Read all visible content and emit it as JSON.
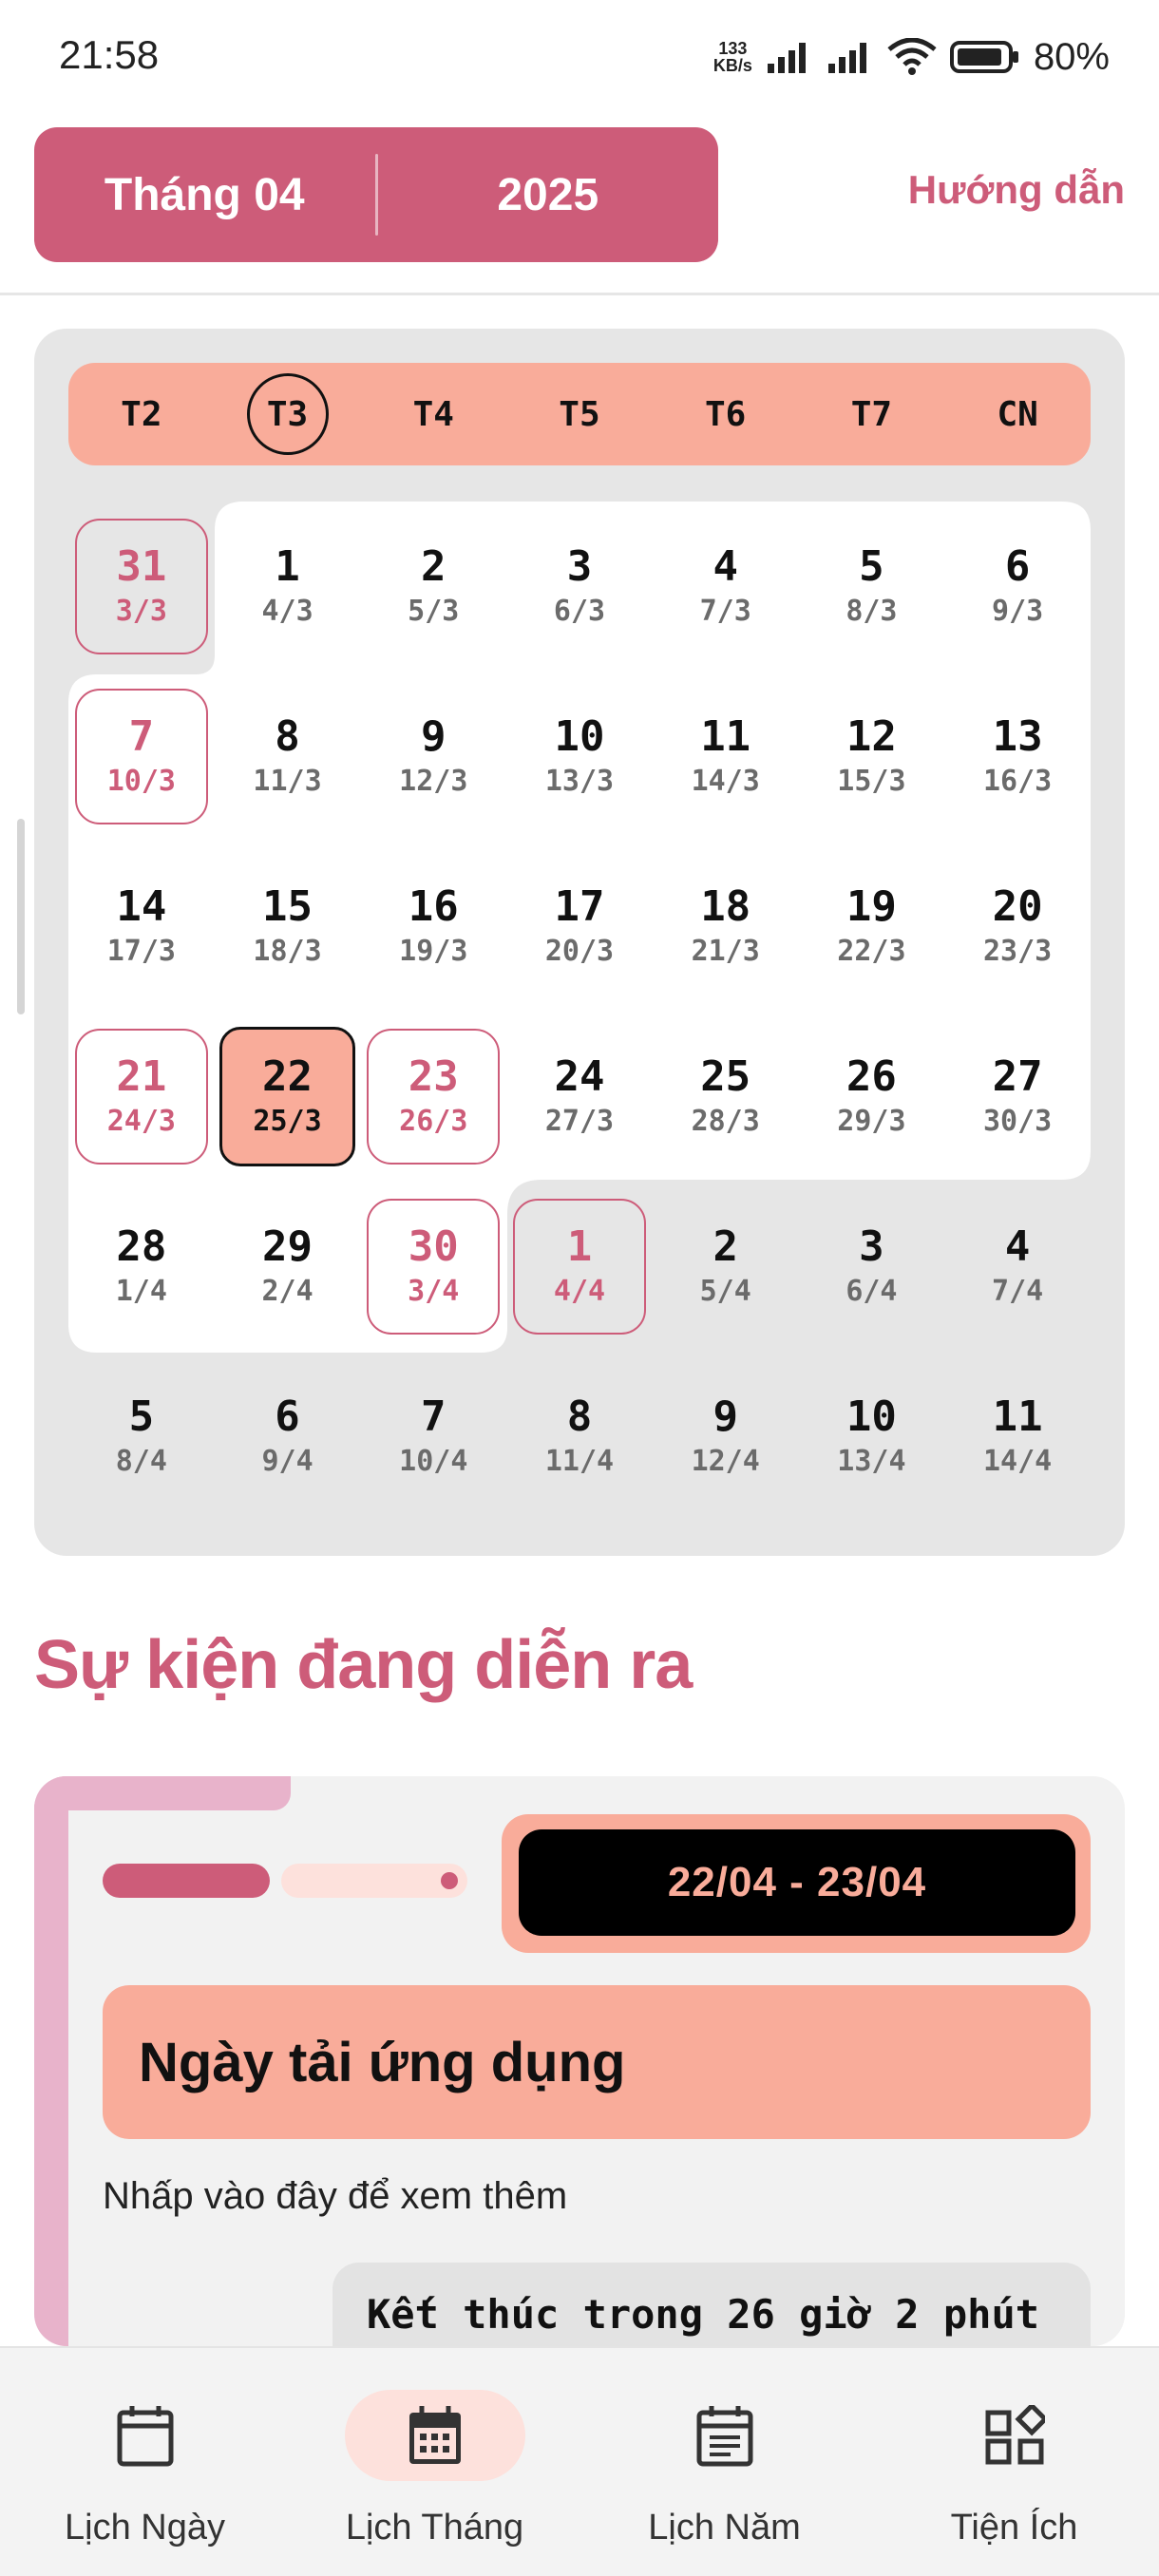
{
  "status_bar": {
    "time": "21:58",
    "net_speed_value": "133",
    "net_speed_unit": "KB/s",
    "battery": "80%",
    "icons": [
      "signal-icon",
      "signal-icon",
      "wifi-icon",
      "battery-icon"
    ]
  },
  "header": {
    "month_label": "Tháng 04",
    "year_label": "2025",
    "guide_link": "Hướng dẫn",
    "accent_color": "#cd5c79"
  },
  "calendar": {
    "weekdays": [
      "T2",
      "T3",
      "T4",
      "T5",
      "T6",
      "T7",
      "CN"
    ],
    "current_weekday": "T3",
    "weeks": [
      [
        {
          "solar": "31",
          "lunar": "3/3",
          "style": "outline"
        },
        {
          "solar": "1",
          "lunar": "4/3"
        },
        {
          "solar": "2",
          "lunar": "5/3"
        },
        {
          "solar": "3",
          "lunar": "6/3"
        },
        {
          "solar": "4",
          "lunar": "7/3"
        },
        {
          "solar": "5",
          "lunar": "8/3"
        },
        {
          "solar": "6",
          "lunar": "9/3"
        }
      ],
      [
        {
          "solar": "7",
          "lunar": "10/3",
          "style": "outline"
        },
        {
          "solar": "8",
          "lunar": "11/3"
        },
        {
          "solar": "9",
          "lunar": "12/3"
        },
        {
          "solar": "10",
          "lunar": "13/3"
        },
        {
          "solar": "11",
          "lunar": "14/3"
        },
        {
          "solar": "12",
          "lunar": "15/3"
        },
        {
          "solar": "13",
          "lunar": "16/3"
        }
      ],
      [
        {
          "solar": "14",
          "lunar": "17/3"
        },
        {
          "solar": "15",
          "lunar": "18/3"
        },
        {
          "solar": "16",
          "lunar": "19/3"
        },
        {
          "solar": "17",
          "lunar": "20/3"
        },
        {
          "solar": "18",
          "lunar": "21/3"
        },
        {
          "solar": "19",
          "lunar": "22/3"
        },
        {
          "solar": "20",
          "lunar": "23/3"
        }
      ],
      [
        {
          "solar": "21",
          "lunar": "24/3",
          "style": "outline"
        },
        {
          "solar": "22",
          "lunar": "25/3",
          "style": "selected"
        },
        {
          "solar": "23",
          "lunar": "26/3",
          "style": "outline"
        },
        {
          "solar": "24",
          "lunar": "27/3"
        },
        {
          "solar": "25",
          "lunar": "28/3"
        },
        {
          "solar": "26",
          "lunar": "29/3"
        },
        {
          "solar": "27",
          "lunar": "30/3"
        }
      ],
      [
        {
          "solar": "28",
          "lunar": "1/4"
        },
        {
          "solar": "29",
          "lunar": "2/4"
        },
        {
          "solar": "30",
          "lunar": "3/4",
          "style": "outline"
        },
        {
          "solar": "1",
          "lunar": "4/4",
          "style": "outline"
        },
        {
          "solar": "2",
          "lunar": "5/4"
        },
        {
          "solar": "3",
          "lunar": "6/4"
        },
        {
          "solar": "4",
          "lunar": "7/4"
        }
      ],
      [
        {
          "solar": "5",
          "lunar": "8/4"
        },
        {
          "solar": "6",
          "lunar": "9/4"
        },
        {
          "solar": "7",
          "lunar": "10/4"
        },
        {
          "solar": "8",
          "lunar": "11/4"
        },
        {
          "solar": "9",
          "lunar": "12/4"
        },
        {
          "solar": "10",
          "lunar": "13/4"
        },
        {
          "solar": "11",
          "lunar": "14/4"
        }
      ]
    ]
  },
  "events": {
    "title": "Sự kiện đang diễn ra",
    "items": [
      {
        "date_range": "22/04 - 23/04",
        "name": "Ngày tải ứng dụng",
        "hint": "Nhấp vào đây để xem thêm",
        "countdown": "Kết thúc trong 26 giờ 2 phút"
      }
    ]
  },
  "bottom_nav": {
    "items": [
      {
        "label": "Lịch Ngày",
        "icon": "calendar-day-icon",
        "active": false
      },
      {
        "label": "Lịch Tháng",
        "icon": "calendar-month-icon",
        "active": true
      },
      {
        "label": "Lịch Năm",
        "icon": "calendar-year-icon",
        "active": false
      },
      {
        "label": "Tiện Ích",
        "icon": "widgets-icon",
        "active": false
      }
    ]
  }
}
